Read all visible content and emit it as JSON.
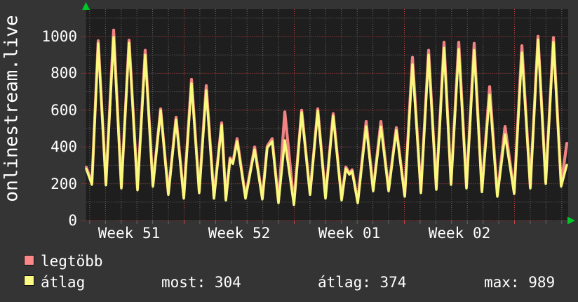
{
  "vertical_label": "onlinestream.live",
  "colors": {
    "background": "#343434",
    "plot_background": "#1e1e1e",
    "grid_minor": "#666666",
    "grid_major": "#c34343",
    "series_max": "#f28383",
    "series_avg": "#f9f97c",
    "swatch_max": "#fb8888",
    "swatch_avg": "#fbfb84",
    "arrow": "#00c828",
    "text": "#ffffff"
  },
  "y_axis": {
    "ticks": [
      {
        "value": 0,
        "label": "0"
      },
      {
        "value": 200,
        "label": "200"
      },
      {
        "value": 400,
        "label": "400"
      },
      {
        "value": 600,
        "label": "600"
      },
      {
        "value": 800,
        "label": "800"
      },
      {
        "value": 1000,
        "label": "1000"
      }
    ]
  },
  "x_axis": {
    "labels": [
      {
        "label": "Week 51"
      },
      {
        "label": "Week 52"
      },
      {
        "label": "Week 01"
      },
      {
        "label": "Week 02"
      }
    ]
  },
  "legend": {
    "items": [
      {
        "label": "legtöbb",
        "swatch_color": "#fb8888"
      },
      {
        "label": "átlag",
        "swatch_color": "#fbfb84"
      }
    ]
  },
  "stats": [
    {
      "text": "most: 304"
    },
    {
      "text": "átlag: 374"
    },
    {
      "text": "max: 989"
    }
  ],
  "chart_data": {
    "type": "line",
    "title": "onlinestream.live",
    "ylabel": "onlinestream.live",
    "ylim": [
      0,
      1140
    ],
    "y_tick_values": [
      0,
      200,
      400,
      600,
      800,
      1000
    ],
    "x_tick_labels": [
      "Week 51",
      "Week 52",
      "Week 01",
      "Week 02"
    ],
    "grid": true,
    "legend_position": "bottom-left",
    "x_unit": "pixel position across plot (time, ~22.43 px per day, red gridlines = week boundaries)",
    "stats": {
      "most": 304,
      "atlag": 374,
      "max": 989
    },
    "series": [
      {
        "name": "legtöbb",
        "color": "#f28383",
        "points": [
          [
            123,
            290
          ],
          [
            131,
            203
          ],
          [
            140,
            977
          ],
          [
            151,
            200
          ],
          [
            162,
            1035
          ],
          [
            173,
            183
          ],
          [
            184,
            980
          ],
          [
            196,
            173
          ],
          [
            207,
            925
          ],
          [
            218,
            193
          ],
          [
            229,
            607
          ],
          [
            240,
            148
          ],
          [
            251,
            561
          ],
          [
            262,
            128
          ],
          [
            273,
            767
          ],
          [
            284,
            158
          ],
          [
            294,
            733
          ],
          [
            305,
            128
          ],
          [
            316,
            531
          ],
          [
            322,
            118
          ],
          [
            328,
            341
          ],
          [
            332,
            316
          ],
          [
            338,
            445
          ],
          [
            350,
            128
          ],
          [
            363,
            400
          ],
          [
            374,
            123
          ],
          [
            381,
            405
          ],
          [
            388,
            445
          ],
          [
            397,
            103
          ],
          [
            406,
            590
          ],
          [
            419,
            93
          ],
          [
            430,
            600
          ],
          [
            442,
            148
          ],
          [
            453,
            607
          ],
          [
            464,
            128
          ],
          [
            475,
            581
          ],
          [
            487,
            118
          ],
          [
            493,
            291
          ],
          [
            498,
            258
          ],
          [
            502,
            276
          ],
          [
            510,
            103
          ],
          [
            522,
            538
          ],
          [
            532,
            168
          ],
          [
            543,
            538
          ],
          [
            554,
            168
          ],
          [
            565,
            505
          ],
          [
            577,
            138
          ],
          [
            588,
            887
          ],
          [
            600,
            158
          ],
          [
            611,
            925
          ],
          [
            622,
            176
          ],
          [
            633,
            969
          ],
          [
            643,
            203
          ],
          [
            654,
            969
          ],
          [
            665,
            183
          ],
          [
            676,
            963
          ],
          [
            687,
            163
          ],
          [
            698,
            728
          ],
          [
            709,
            138
          ],
          [
            720,
            511
          ],
          [
            733,
            153
          ],
          [
            744,
            950
          ],
          [
            756,
            183
          ],
          [
            767,
            1001
          ],
          [
            778,
            208
          ],
          [
            789,
            995
          ],
          [
            800,
            193
          ],
          [
            808,
            420
          ]
        ]
      },
      {
        "name": "átlag",
        "color": "#f9f97c",
        "points": [
          [
            123,
            280
          ],
          [
            131,
            195
          ],
          [
            140,
            962
          ],
          [
            151,
            192
          ],
          [
            162,
            996
          ],
          [
            173,
            175
          ],
          [
            184,
            965
          ],
          [
            196,
            165
          ],
          [
            207,
            900
          ],
          [
            218,
            185
          ],
          [
            229,
            598
          ],
          [
            240,
            140
          ],
          [
            251,
            548
          ],
          [
            262,
            120
          ],
          [
            273,
            745
          ],
          [
            284,
            150
          ],
          [
            294,
            706
          ],
          [
            305,
            120
          ],
          [
            316,
            518
          ],
          [
            322,
            110
          ],
          [
            328,
            333
          ],
          [
            332,
            308
          ],
          [
            338,
            430
          ],
          [
            350,
            120
          ],
          [
            363,
            385
          ],
          [
            374,
            115
          ],
          [
            381,
            395
          ],
          [
            388,
            430
          ],
          [
            397,
            95
          ],
          [
            406,
            435
          ],
          [
            419,
            85
          ],
          [
            430,
            588
          ],
          [
            442,
            140
          ],
          [
            453,
            595
          ],
          [
            464,
            120
          ],
          [
            475,
            568
          ],
          [
            487,
            110
          ],
          [
            493,
            282
          ],
          [
            498,
            250
          ],
          [
            502,
            268
          ],
          [
            510,
            95
          ],
          [
            522,
            511
          ],
          [
            532,
            160
          ],
          [
            543,
            510
          ],
          [
            554,
            160
          ],
          [
            565,
            490
          ],
          [
            577,
            130
          ],
          [
            588,
            848
          ],
          [
            600,
            150
          ],
          [
            611,
            900
          ],
          [
            622,
            168
          ],
          [
            633,
            938
          ],
          [
            643,
            195
          ],
          [
            654,
            931
          ],
          [
            665,
            175
          ],
          [
            676,
            925
          ],
          [
            687,
            155
          ],
          [
            698,
            683
          ],
          [
            709,
            130
          ],
          [
            720,
            467
          ],
          [
            733,
            145
          ],
          [
            744,
            912
          ],
          [
            756,
            175
          ],
          [
            767,
            982
          ],
          [
            778,
            200
          ],
          [
            789,
            969
          ],
          [
            800,
            185
          ],
          [
            808,
            302
          ]
        ]
      }
    ]
  }
}
